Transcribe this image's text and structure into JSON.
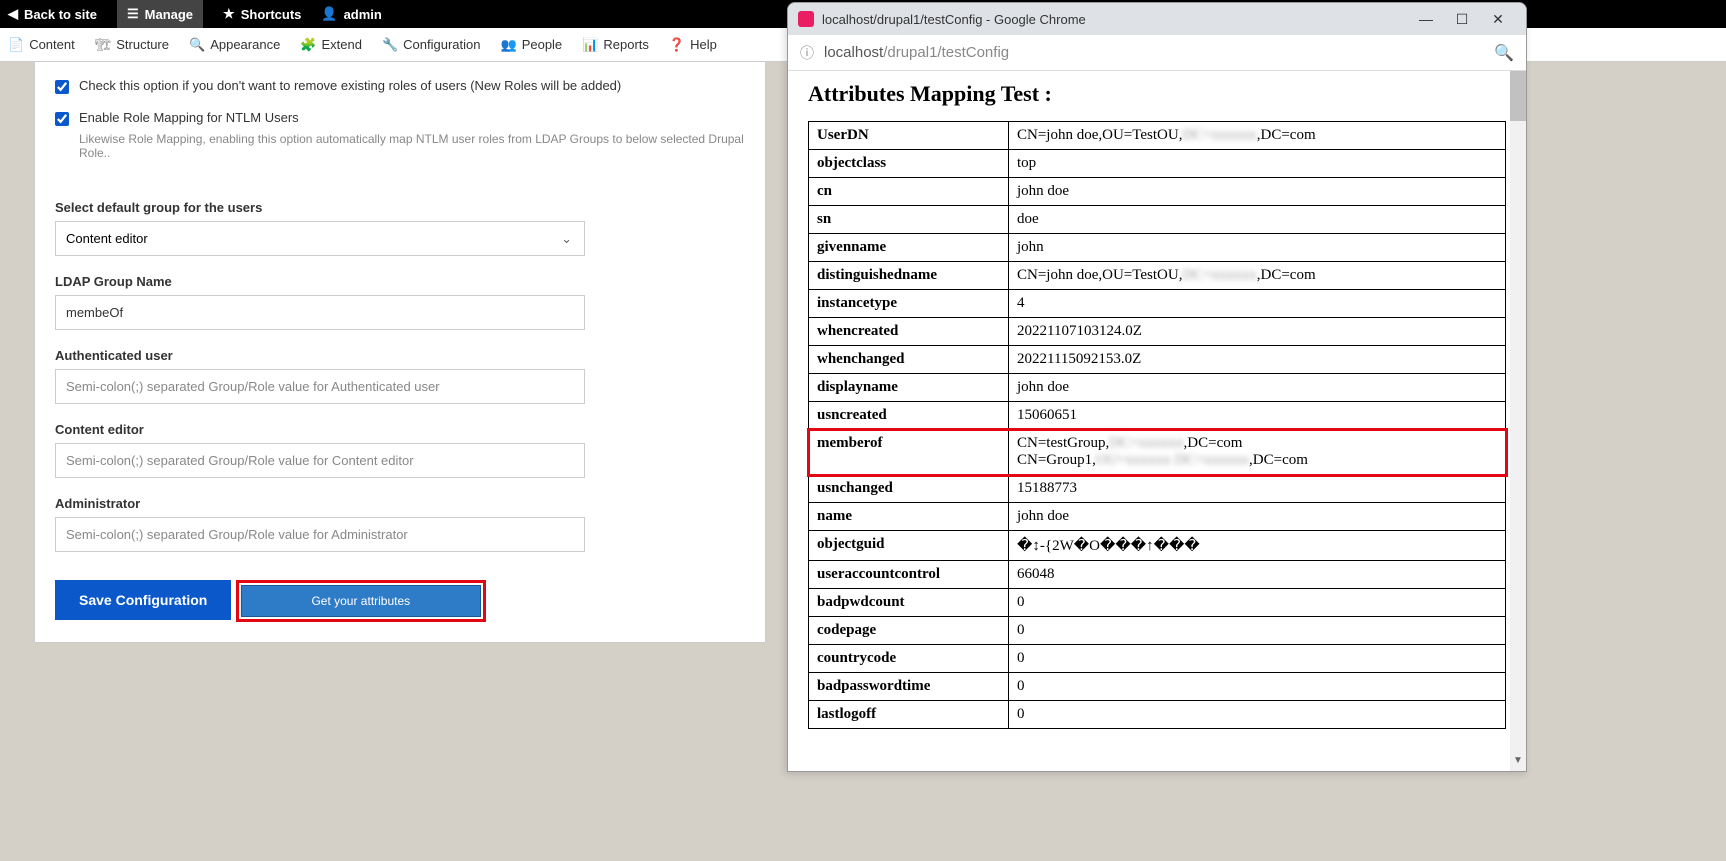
{
  "topbar": {
    "back": "Back to site",
    "manage": "Manage",
    "shortcuts": "Shortcuts",
    "admin": "admin"
  },
  "tabs": {
    "content": "Content",
    "structure": "Structure",
    "appearance": "Appearance",
    "extend": "Extend",
    "configuration": "Configuration",
    "people": "People",
    "reports": "Reports",
    "help": "Help"
  },
  "form": {
    "check1": "Check this option if you don't want to remove existing roles of users (New Roles will be added)",
    "check2": "Enable Role Mapping for NTLM Users",
    "check2_sub": "Likewise Role Mapping, enabling this option automatically map NTLM user roles from LDAP Groups to below selected Drupal Role..",
    "default_group_label": "Select default group for the users",
    "default_group_value": "Content editor",
    "ldap_group_label": "LDAP Group Name",
    "ldap_group_value": "membeOf",
    "auth_user_label": "Authenticated user",
    "auth_user_placeholder": "Semi-colon(;) separated Group/Role value for Authenticated user",
    "content_editor_label": "Content editor",
    "content_editor_placeholder": "Semi-colon(;) separated Group/Role value for Content editor",
    "admin_label": "Administrator",
    "admin_placeholder": "Semi-colon(;) separated Group/Role value for Administrator",
    "save_btn": "Save Configuration",
    "get_attr_btn": "Get your attributes"
  },
  "chrome": {
    "title": "localhost/drupal1/testConfig - Google Chrome",
    "url_prefix": "localhost",
    "url_suffix": "/drupal1/testConfig",
    "heading": "Attributes Mapping Test :",
    "attrs": [
      {
        "key": "UserDN",
        "val": "CN=john doe,OU=TestOU,",
        "blur": "DC=xxxxxx",
        "val2": ",DC=com"
      },
      {
        "key": "objectclass",
        "val": "top"
      },
      {
        "key": "cn",
        "val": "john doe"
      },
      {
        "key": "sn",
        "val": "doe"
      },
      {
        "key": "givenname",
        "val": "john"
      },
      {
        "key": "distinguishedname",
        "val": "CN=john doe,OU=TestOU,",
        "blur": "DC=xxxxxx",
        "val2": ",DC=com"
      },
      {
        "key": "instancetype",
        "val": "4"
      },
      {
        "key": "whencreated",
        "val": "20221107103124.0Z"
      },
      {
        "key": "whenchanged",
        "val": "20221115092153.0Z"
      },
      {
        "key": "displayname",
        "val": "john doe"
      },
      {
        "key": "usncreated",
        "val": "15060651"
      },
      {
        "key": "memberof",
        "line1a": "CN=testGroup,",
        "line1b": "DC=xxxxxx",
        "line1c": ",DC=com",
        "line2a": "CN=Group1,",
        "line2b": "OU=xxxxxx DC=xxxxxx",
        "line2c": ",DC=com",
        "highlight": true
      },
      {
        "key": "usnchanged",
        "val": "15188773"
      },
      {
        "key": "name",
        "val": "john doe"
      },
      {
        "key": "objectguid",
        "val": "�↕-{2W�O���↑���"
      },
      {
        "key": "useraccountcontrol",
        "val": "66048"
      },
      {
        "key": "badpwdcount",
        "val": "0"
      },
      {
        "key": "codepage",
        "val": "0"
      },
      {
        "key": "countrycode",
        "val": "0"
      },
      {
        "key": "badpasswordtime",
        "val": "0"
      },
      {
        "key": "lastlogoff",
        "val": "0"
      }
    ]
  }
}
